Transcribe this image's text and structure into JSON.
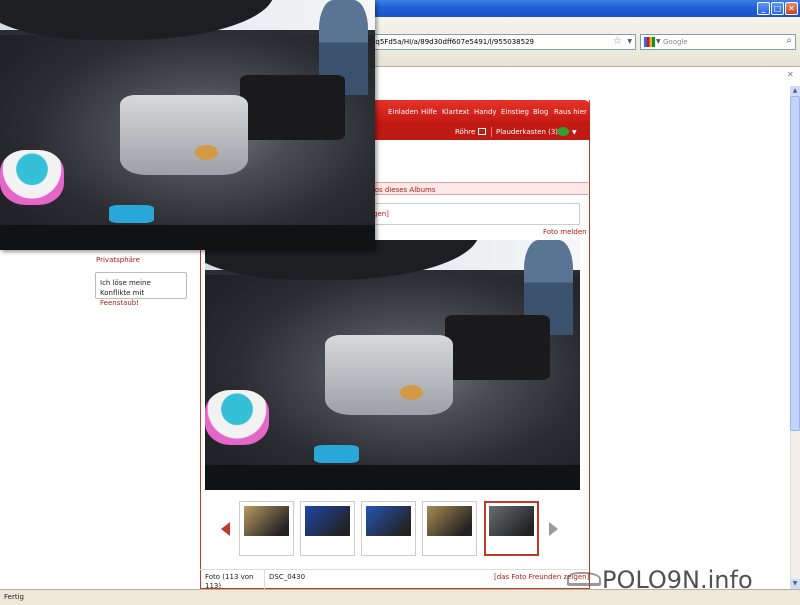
{
  "browser": {
    "url": "nq5Fd5a/HI/a/89d30dff607e5491/l/955038529",
    "search_placeholder": "Google",
    "status": "Fertig",
    "window_buttons": {
      "minimize": "_",
      "maximize": "□",
      "close": "✕"
    }
  },
  "site": {
    "topnav": [
      "Einladen",
      "Hilfe",
      "Klartext",
      "Handy",
      "Einstieg",
      "Blog",
      "Raus hier"
    ],
    "subnav": {
      "tv": "Röhre",
      "chat": "Plauderkasten (3)"
    },
    "album_text": "tos dieses Albums",
    "comment_link": "gen]",
    "report_link": "Foto melden",
    "privacy": "Privatsphäre",
    "status_text": "Ich löse meine Konflikte mit",
    "status_link": "Feenstaub",
    "status_end": "!",
    "photo_count": "Foto (113 von 113)",
    "photo_name": "DSC_0430",
    "share_link": "[das Foto Freunden zeigen]"
  },
  "watermark": "POLO9N.info",
  "thumbnails": [
    {
      "name": "thumb-interior",
      "color": "#b89a62"
    },
    {
      "name": "thumb-blue-car",
      "color": "#1f47a8"
    },
    {
      "name": "thumb-taillight",
      "color": "#2655b5"
    },
    {
      "name": "thumb-dashboard",
      "color": "#a88a52"
    },
    {
      "name": "thumb-engine",
      "color": "#6a6d73",
      "active": true
    }
  ]
}
